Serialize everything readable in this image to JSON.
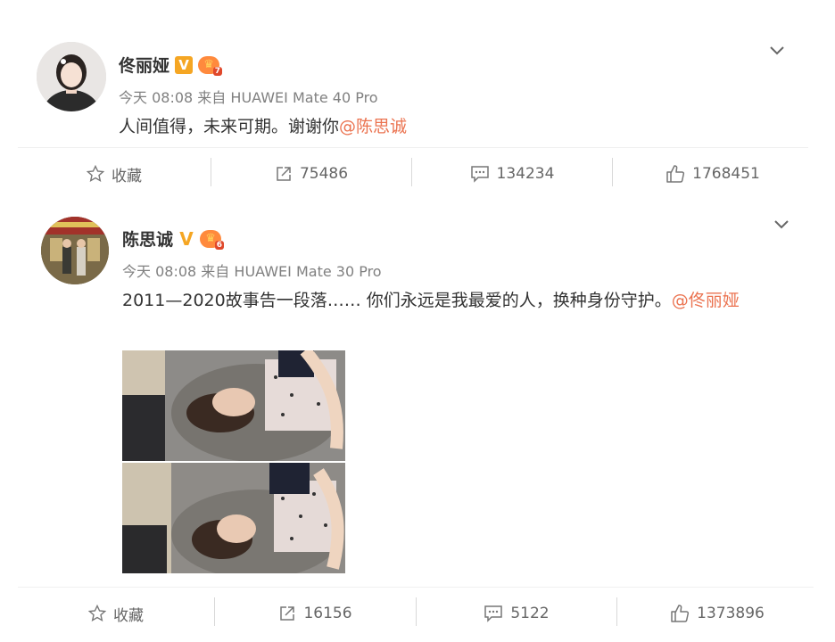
{
  "post1": {
    "username": "佟丽娅",
    "badge_v": "V",
    "level": "7",
    "time": "今天 08:08",
    "source_prefix": "来自",
    "source_device": "HUAWEI Mate 40 Pro",
    "text": "人间值得，未来可期。谢谢你",
    "mention": "@陈思诚",
    "actions": {
      "favorite": "收藏",
      "repost": "75486",
      "comment": "134234",
      "like": "1768451"
    }
  },
  "post2": {
    "username": "陈思诚",
    "badge_v": "V",
    "level": "6",
    "time": "今天 08:08",
    "source_prefix": "来自",
    "source_device": "HUAWEI Mate 30 Pro",
    "text": "2011—2020故事告一段落…… 你们永远是我最爱的人，换种身份守护。",
    "mention": "@佟丽娅",
    "actions": {
      "favorite": "收藏",
      "repost": "16156",
      "comment": "5122",
      "like": "1373896"
    }
  },
  "colors": {
    "mention": "#eb7350",
    "verified": "#f5a623",
    "meta": "#808080"
  },
  "icons": {
    "favorite": "star-icon",
    "repost": "share-icon",
    "comment": "comment-icon",
    "like": "thumbs-up-icon",
    "menu": "chevron-down-icon"
  }
}
